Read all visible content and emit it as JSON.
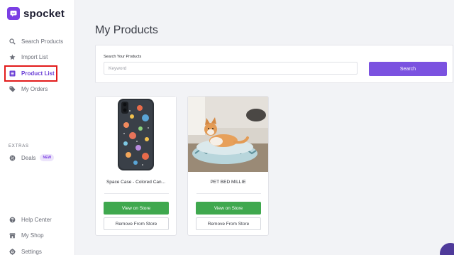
{
  "app": {
    "name": "spocket",
    "brand_color": "#7b3fe4"
  },
  "sidebar": {
    "items": [
      {
        "label": "Search Products",
        "icon": "search-icon"
      },
      {
        "label": "Import List",
        "icon": "star-icon"
      },
      {
        "label": "Product List",
        "icon": "list-icon",
        "active": true
      },
      {
        "label": "My Orders",
        "icon": "tag-icon"
      }
    ],
    "extras_label": "EXTRAS",
    "extras": [
      {
        "label": "Deals",
        "icon": "deal-icon",
        "badge": "NEW"
      }
    ],
    "footer": [
      {
        "label": "Help Center",
        "icon": "help-icon"
      },
      {
        "label": "My Shop",
        "icon": "shop-icon"
      },
      {
        "label": "Settings",
        "icon": "gear-icon"
      }
    ]
  },
  "main": {
    "title": "My Products",
    "search": {
      "label": "Search Your Products",
      "placeholder": "Keyword",
      "button": "Search"
    },
    "products": [
      {
        "title": "Space Case - Colored Can...",
        "view_label": "View on Store",
        "remove_label": "Remove From Store"
      },
      {
        "title": "PET BED MILLIE",
        "view_label": "View on Store",
        "remove_label": "Remove From Store"
      }
    ]
  }
}
